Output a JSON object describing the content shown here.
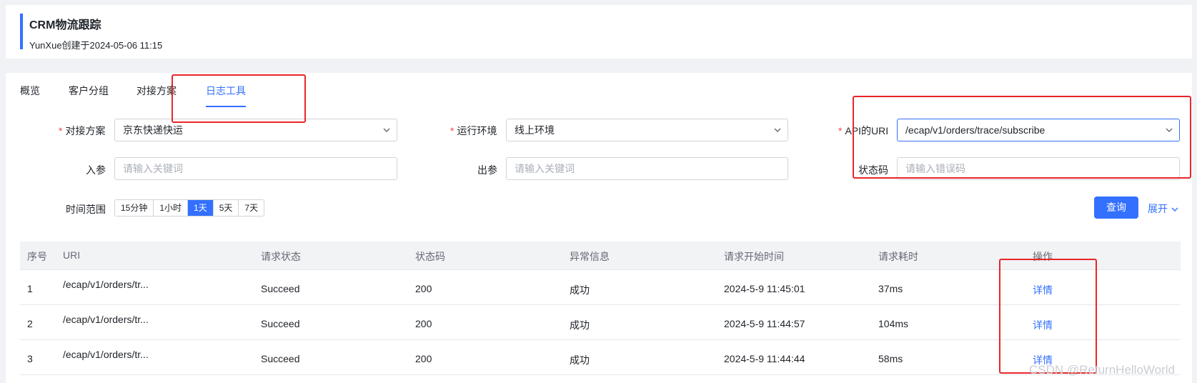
{
  "header": {
    "title": "CRM物流跟踪",
    "subtitle": "YunXue创建于2024-05-06 11:15"
  },
  "tabs": [
    {
      "label": "概览"
    },
    {
      "label": "客户分组"
    },
    {
      "label": "对接方案"
    },
    {
      "label": "日志工具",
      "active": true
    }
  ],
  "form": {
    "plan": {
      "label": "对接方案",
      "value": "京东快递快运"
    },
    "env": {
      "label": "运行环境",
      "value": "线上环境"
    },
    "api_uri": {
      "label": "API的URI",
      "value": "/ecap/v1/orders/trace/subscribe"
    },
    "input_param": {
      "label": "入参",
      "placeholder": "请输入关键词"
    },
    "output_param": {
      "label": "出参",
      "placeholder": "请输入关键词"
    },
    "status_code": {
      "label": "状态码",
      "placeholder": "请输入错误码"
    },
    "time_range": {
      "label": "时间范围",
      "options": [
        "15分钟",
        "1小时",
        "1天",
        "5天",
        "7天"
      ],
      "selected": "1天"
    },
    "query_button": "查询",
    "expand_link": "展开"
  },
  "table": {
    "columns": [
      "序号",
      "URI",
      "请求状态",
      "状态码",
      "异常信息",
      "请求开始时间",
      "请求耗时",
      "操作"
    ],
    "rows": [
      {
        "index": "1",
        "uri": "/ecap/v1/orders/tr...",
        "status": "Succeed",
        "code": "200",
        "message": "成功",
        "start_time": "2024-5-9 11:45:01",
        "duration": "37ms",
        "action": "详情"
      },
      {
        "index": "2",
        "uri": "/ecap/v1/orders/tr...",
        "status": "Succeed",
        "code": "200",
        "message": "成功",
        "start_time": "2024-5-9 11:44:57",
        "duration": "104ms",
        "action": "详情"
      },
      {
        "index": "3",
        "uri": "/ecap/v1/orders/tr...",
        "status": "Succeed",
        "code": "200",
        "message": "成功",
        "start_time": "2024-5-9 11:44:44",
        "duration": "58ms",
        "action": "详情"
      }
    ]
  },
  "watermark": "CSDN @ReturnHelloWorld",
  "colors": {
    "accent": "#3370ff",
    "required": "#f54a45",
    "annotation": "#e8262a"
  }
}
